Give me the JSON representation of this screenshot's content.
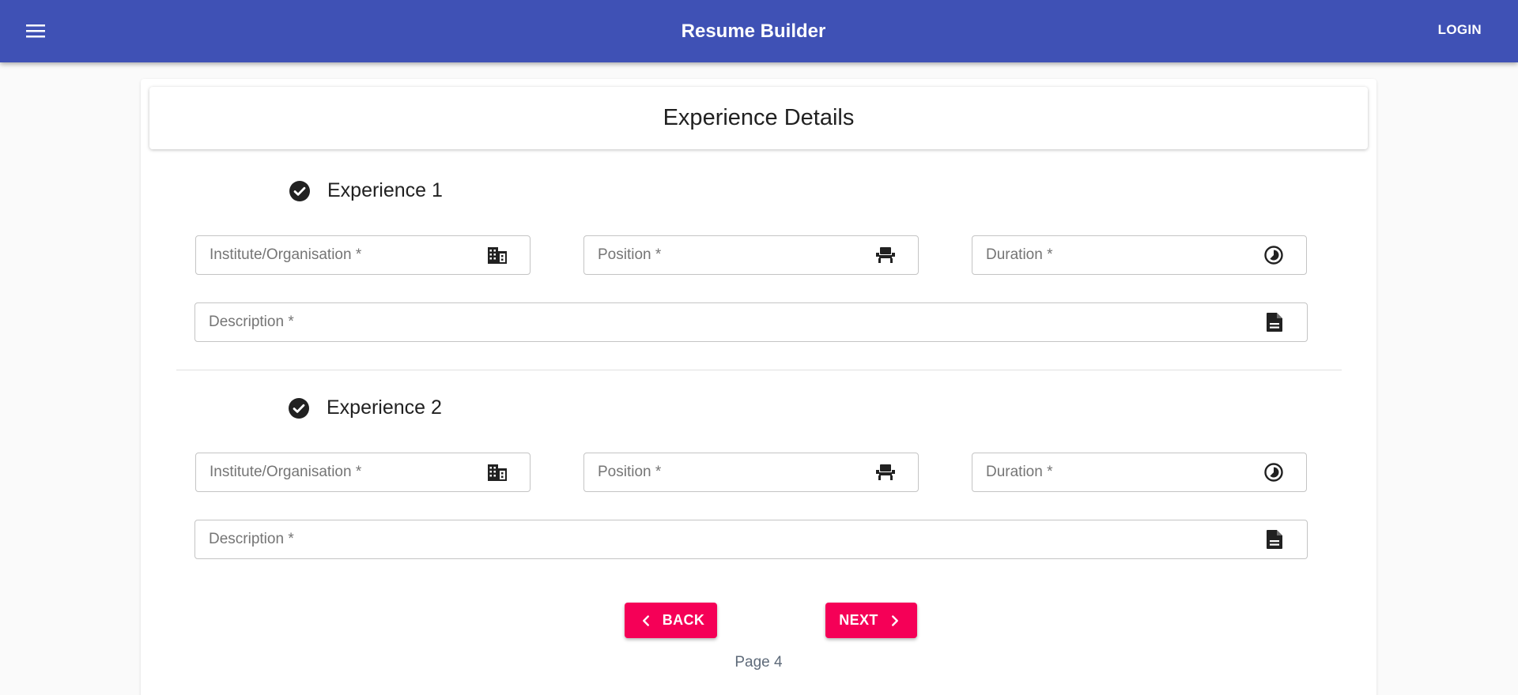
{
  "header": {
    "title": "Resume Builder",
    "login_label": "LOGIN",
    "menu_icon": "menu-icon"
  },
  "section": {
    "title": "Experience Details"
  },
  "experiences": [
    {
      "heading": "Experience 1",
      "institute_placeholder": "Institute/Organisation *",
      "position_placeholder": "Position *",
      "duration_placeholder": "Duration *",
      "description_placeholder": "Description *"
    },
    {
      "heading": "Experience 2",
      "institute_placeholder": "Institute/Organisation *",
      "position_placeholder": "Position *",
      "duration_placeholder": "Duration *",
      "description_placeholder": "Description *"
    }
  ],
  "navigation": {
    "back_label": "BACK",
    "next_label": "NEXT",
    "page_label": "Page 4"
  },
  "colors": {
    "appbar": "#3f51b5",
    "button": "#f50057"
  },
  "icons": {
    "heading": "check-circle-icon",
    "institute": "business-icon",
    "position": "event-seat-icon",
    "duration": "timelapse-icon",
    "description": "description-icon"
  }
}
